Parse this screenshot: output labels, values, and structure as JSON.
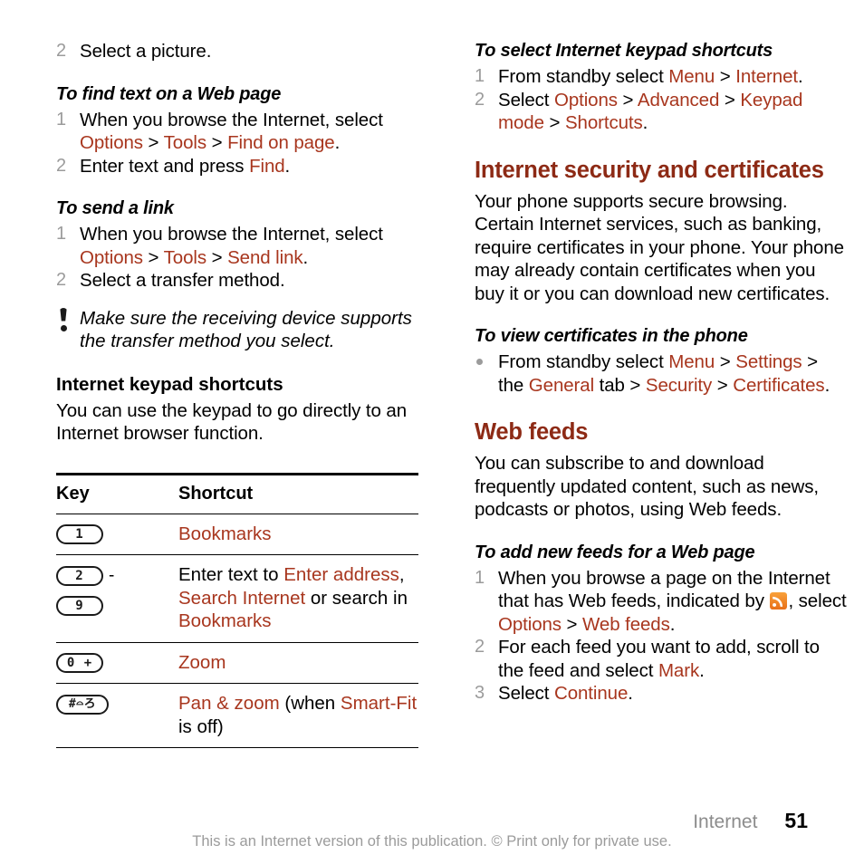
{
  "page": {
    "number": "51",
    "section": "Internet",
    "legal": "This is an Internet version of this publication. © Print only for private use."
  },
  "left_column": {
    "orphan_step": {
      "marker": "2",
      "text": "Select a picture."
    },
    "proc_find_text": {
      "heading": "To find text on a Web page",
      "steps": [
        {
          "marker": "1",
          "lead": "When you browse the Internet, select ",
          "links": [
            "Options",
            "Tools",
            "Find on page"
          ],
          "tail": "."
        },
        {
          "marker": "2",
          "lead": "Enter text and press ",
          "links": [
            "Find"
          ],
          "tail": "."
        }
      ]
    },
    "proc_send_link": {
      "heading": "To send a link",
      "steps": [
        {
          "marker": "1",
          "lead": "When you browse the Internet, select ",
          "links": [
            "Options",
            "Tools",
            "Send link"
          ],
          "tail": "."
        },
        {
          "marker": "2",
          "lead": "Select a transfer method.",
          "links": [],
          "tail": ""
        }
      ]
    },
    "note": {
      "icon": "exclamation-tip-icon",
      "text": "Make sure the receiving device supports the transfer method you select."
    },
    "keypad_shortcuts": {
      "heading": "Internet keypad shortcuts",
      "body": "You can use the keypad to go directly to an Internet browser function."
    },
    "key_table": {
      "headers": [
        "Key",
        "Shortcut"
      ],
      "rows": [
        {
          "keys": [
            "1"
          ],
          "range": false,
          "shortcut_parts": [
            {
              "text": "Bookmarks",
              "link": true
            }
          ]
        },
        {
          "keys": [
            "2",
            "9"
          ],
          "range": true,
          "range_dash": "-",
          "shortcut_parts": [
            {
              "text": "Enter text to ",
              "link": false
            },
            {
              "text": "Enter address",
              "link": true
            },
            {
              "text": ", ",
              "link": false
            },
            {
              "text": "Search Internet",
              "link": true
            },
            {
              "text": " or search in ",
              "link": false
            },
            {
              "text": "Bookmarks",
              "link": true
            }
          ]
        },
        {
          "keys": [
            "0 +"
          ],
          "range": false,
          "shortcut_parts": [
            {
              "text": "Zoom",
              "link": true
            }
          ]
        },
        {
          "keys": [
            "#⌓ろ"
          ],
          "range": false,
          "shortcut_parts": [
            {
              "text": "Pan & zoom",
              "link": true
            },
            {
              "text": " (when ",
              "link": false
            },
            {
              "text": "Smart-Fit",
              "link": true
            },
            {
              "text": " is off)",
              "link": false
            }
          ]
        }
      ]
    }
  },
  "right_column": {
    "proc_select_shortcuts": {
      "heading": "To select Internet keypad shortcuts",
      "steps": [
        {
          "marker": "1",
          "lead": "From standby select ",
          "links": [
            "Menu",
            "Internet"
          ],
          "tail": "."
        },
        {
          "marker": "2",
          "lead": "Select ",
          "links": [
            "Options",
            "Advanced",
            "Keypad mode",
            "Shortcuts"
          ],
          "tail": "."
        }
      ]
    },
    "security_section": {
      "heading": "Internet security and certificates",
      "body": "Your phone supports secure browsing. Certain Internet services, such as banking, require certificates in your phone. Your phone may already contain certificates when you buy it or you can download new certificates."
    },
    "proc_view_certificates": {
      "heading": "To view certificates in the phone",
      "bullet": {
        "p1": "From standby select ",
        "l1": "Menu",
        "s1": " > ",
        "l2": "Settings",
        "s2": " > the ",
        "l3": "General",
        "s3": " tab > ",
        "l4": "Security",
        "s4": " > ",
        "l5": "Certificates",
        "tail": "."
      }
    },
    "webfeeds_section": {
      "heading": "Web feeds",
      "body": "You can subscribe to and download frequently updated content, such as news, podcasts or photos, using Web feeds."
    },
    "proc_add_feeds": {
      "heading": "To add new feeds for a Web page",
      "steps": [
        {
          "marker": "1",
          "p1": "When you browse a page on the Internet that has Web feeds, indicated by ",
          "icon": "rss-feed-icon",
          "p2": ", select ",
          "l1": "Options",
          "s1": " > ",
          "l2": "Web feeds",
          "tail": "."
        },
        {
          "marker": "2",
          "p1": "For each feed you want to add, scroll to the feed and select ",
          "l1": "Mark",
          "tail": "."
        },
        {
          "marker": "3",
          "p1": "Select ",
          "l1": "Continue",
          "tail": "."
        }
      ]
    }
  },
  "colors": {
    "link": "#a8361e",
    "heading": "#8d2a15",
    "marker": "#9b9b9b",
    "rss_orange": "#ef8023"
  }
}
